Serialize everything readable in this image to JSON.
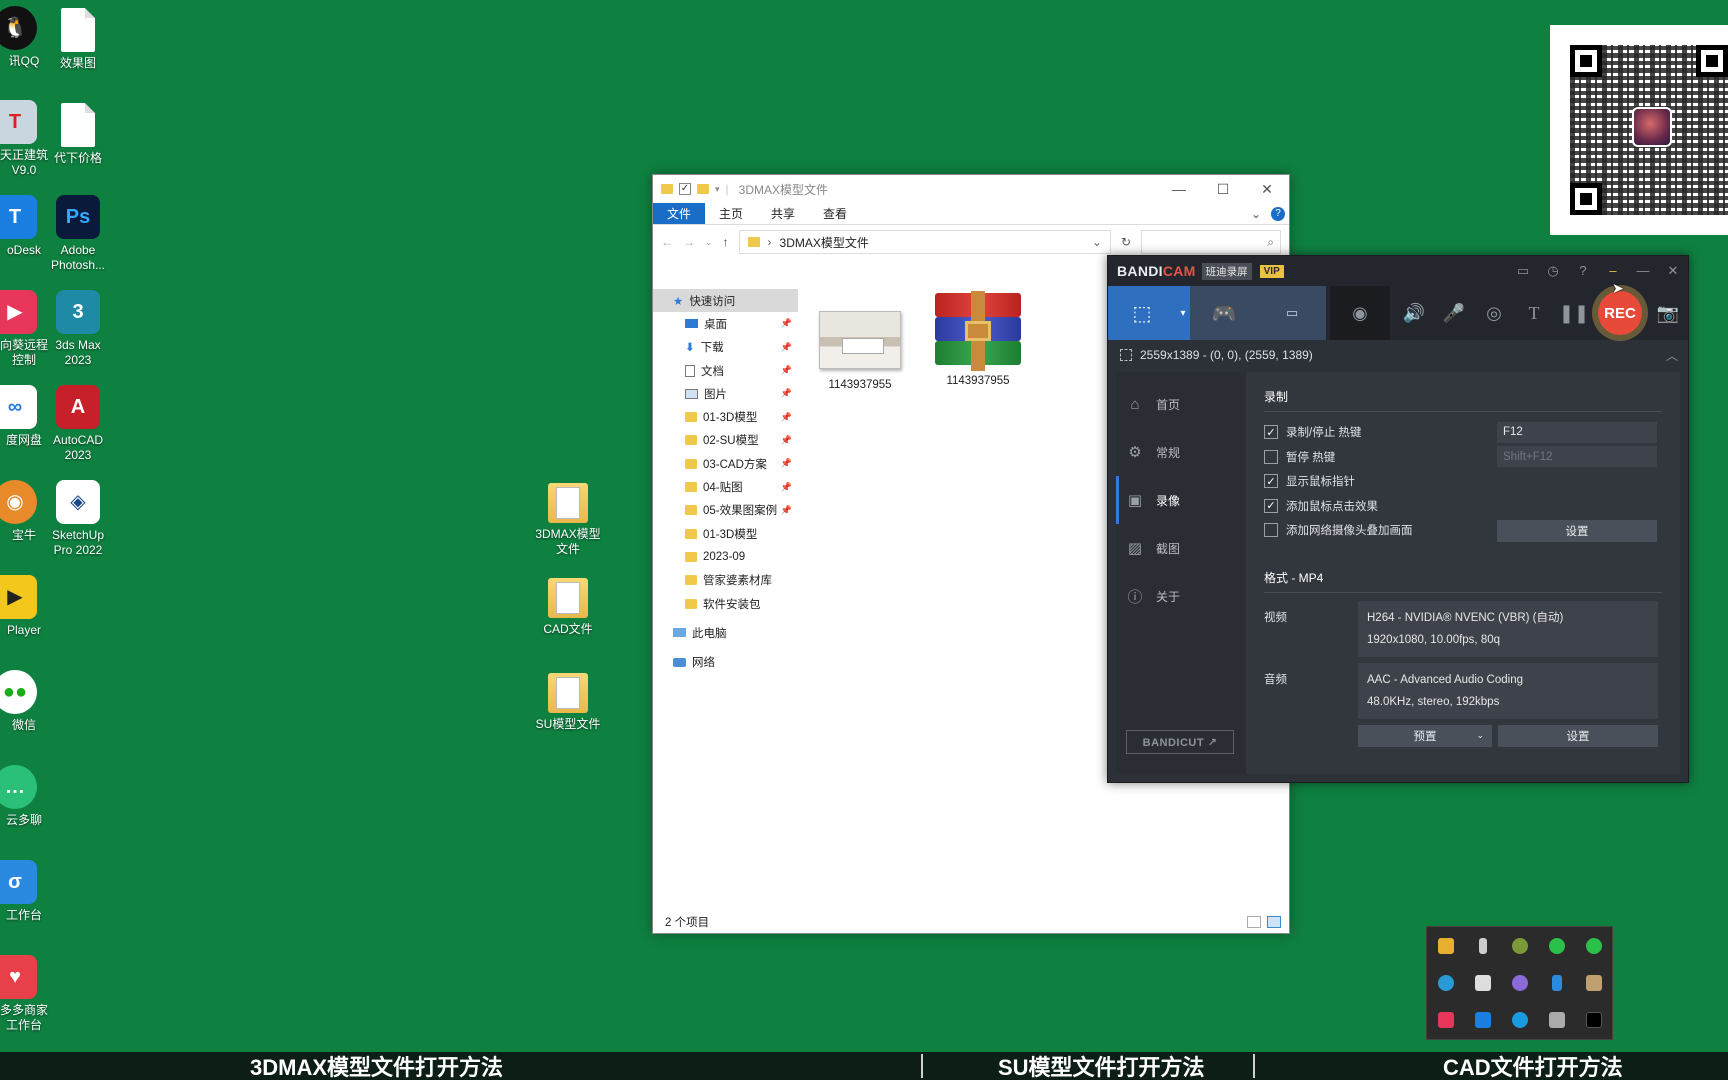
{
  "desktop": {
    "icons": [
      {
        "label": "讯QQ",
        "icon": "qq-penguin-icon"
      },
      {
        "label": "效果图",
        "icon": "document-icon"
      },
      {
        "label": "天正建筑\nV9.0",
        "icon": "tangent-arch-icon"
      },
      {
        "label": "代下价格",
        "icon": "document-icon"
      },
      {
        "label": "oDesk",
        "icon": "todesk-icon"
      },
      {
        "label": "Adobe\nPhotosh...",
        "icon": "photoshop-icon"
      },
      {
        "label": "向葵远程\n控制",
        "icon": "sunflower-remote-icon"
      },
      {
        "label": "3ds Max\n2023",
        "icon": "3dsmax-icon"
      },
      {
        "label": "度网盘",
        "icon": "baidu-netdisk-icon"
      },
      {
        "label": "AutoCAD\n2023",
        "icon": "autocad-icon"
      },
      {
        "label": "宝牛",
        "icon": "cow-app-icon"
      },
      {
        "label": "SketchUp\nPro 2022",
        "icon": "sketchup-icon"
      },
      {
        "label": "Player",
        "icon": "potplayer-icon"
      },
      {
        "label": "微信",
        "icon": "wechat-icon"
      },
      {
        "label": "云多聊",
        "icon": "chat-app-icon"
      },
      {
        "label": "工作台",
        "icon": "workbench-icon"
      },
      {
        "label": "多多商家\n工作台",
        "icon": "pinduoduo-icon"
      },
      {
        "label": "3DMAX模型\n文件",
        "icon": "folder-icon"
      },
      {
        "label": "CAD文件",
        "icon": "folder-icon"
      },
      {
        "label": "SU模型文件",
        "icon": "folder-icon"
      }
    ]
  },
  "explorer": {
    "title": "3DMAX模型文件",
    "win_min": "—",
    "win_max": "☐",
    "win_close": "✕",
    "ribbon_tabs": [
      "文件",
      "主页",
      "共享",
      "查看"
    ],
    "help": "?",
    "address": "3DMAX模型文件",
    "nav_items": [
      {
        "label": "快速访问",
        "icon": "star-icon",
        "pinned": false
      },
      {
        "label": "桌面",
        "icon": "desktop-icon",
        "pinned": true
      },
      {
        "label": "下载",
        "icon": "download-icon",
        "pinned": true
      },
      {
        "label": "文档",
        "icon": "documents-icon",
        "pinned": true
      },
      {
        "label": "图片",
        "icon": "pictures-icon",
        "pinned": true
      },
      {
        "label": "01-3D模型",
        "icon": "folder-icon",
        "pinned": true
      },
      {
        "label": "02-SU模型",
        "icon": "folder-icon",
        "pinned": true
      },
      {
        "label": "03-CAD方案",
        "icon": "folder-icon",
        "pinned": true
      },
      {
        "label": "04-贴图",
        "icon": "folder-icon",
        "pinned": true
      },
      {
        "label": "05-效果图案例",
        "icon": "folder-icon",
        "pinned": true
      },
      {
        "label": "01-3D模型",
        "icon": "folder-icon",
        "pinned": false
      },
      {
        "label": "2023-09",
        "icon": "folder-icon",
        "pinned": false
      },
      {
        "label": "管家婆素材库",
        "icon": "folder-icon",
        "pinned": false
      },
      {
        "label": "软件安装包",
        "icon": "folder-icon",
        "pinned": false
      },
      {
        "label": "此电脑",
        "icon": "this-pc-icon",
        "pinned": false
      },
      {
        "label": "网络",
        "icon": "network-icon",
        "pinned": false
      }
    ],
    "files": [
      {
        "name": "1143937955",
        "type": "image-thumbnail"
      },
      {
        "name": "1143937955",
        "type": "rar-archive"
      }
    ],
    "status": "2 个项目"
  },
  "bandicam": {
    "logo_a": "BANDI",
    "logo_b": "CAM",
    "subtitle": "班迪录屏",
    "vip": "VIP",
    "rec_label": "REC",
    "region": "2559x1389 - (0, 0), (2559, 1389)",
    "sidebar": [
      "首页",
      "常规",
      "录像",
      "截图",
      "关于"
    ],
    "bandicut": "BANDICUT ↗",
    "record_section": "录制",
    "options": [
      {
        "label": "录制/停止 热键",
        "checked": true,
        "hotkey": "F12"
      },
      {
        "label": "暂停 热键",
        "checked": false,
        "hotkey": "Shift+F12"
      },
      {
        "label": "显示鼠标指针",
        "checked": true
      },
      {
        "label": "添加鼠标点击效果",
        "checked": true
      },
      {
        "label": "添加网络摄像头叠加画面",
        "checked": false
      }
    ],
    "settings_btn": "设置",
    "format_section": "格式 - MP4",
    "video_label": "视频",
    "video_line1": "H264 - NVIDIA® NVENC (VBR) (自动)",
    "video_line2": "1920x1080, 10.00fps, 80q",
    "audio_label": "音频",
    "audio_line1": "AAC - Advanced Audio Coding",
    "audio_line2": "48.0KHz, stereo, 192kbps",
    "preset_btn": "预置",
    "settings_btn2": "设置"
  },
  "captions": [
    "3DMAX模型文件打开方法",
    "SU模型文件打开方法",
    "CAD文件打开方法"
  ],
  "colors": {
    "desktop_bg": "#0e8040",
    "explorer_accent": "#1a6dc7",
    "bandicam_bg": "#2c3037",
    "bandicam_mode": "#2f6fbf",
    "rec_red": "#e84a3a"
  }
}
